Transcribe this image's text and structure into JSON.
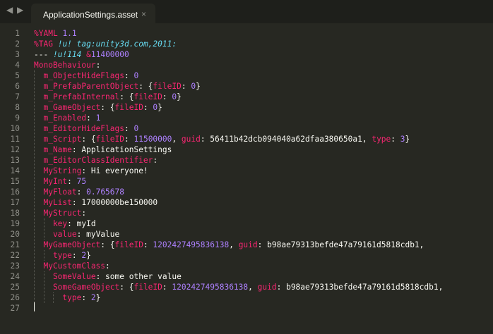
{
  "tab": {
    "title": "ApplicationSettings.asset",
    "close_symbol": "×"
  },
  "nav": {
    "back_symbol": "◀",
    "forward_symbol": "▶"
  },
  "colors": {
    "background": "#272822",
    "key": "#f92672",
    "number": "#ae81ff",
    "string": "#e6db74",
    "tag": "#66d9ef",
    "text": "#f8f8f2"
  },
  "lines": [
    {
      "n": "1",
      "tokens": [
        [
          "%",
          "pink"
        ],
        [
          "YAML",
          "pink"
        ],
        [
          " 1.1",
          "purple"
        ]
      ]
    },
    {
      "n": "2",
      "tokens": [
        [
          "%",
          "pink"
        ],
        [
          "TAG",
          "pink"
        ],
        [
          " !u! tag:unity3d.com,2011:",
          "cyan"
        ]
      ]
    },
    {
      "n": "3",
      "tokens": [
        [
          "--- ",
          "plain"
        ],
        [
          "!u!114",
          "cyan"
        ],
        [
          " &",
          "pink"
        ],
        [
          "11400000",
          "purple"
        ]
      ]
    },
    {
      "n": "4",
      "tokens": [
        [
          "MonoBehaviour",
          "key"
        ],
        [
          ":",
          "punct"
        ]
      ]
    },
    {
      "n": "5",
      "tokens": [
        [
          "  m_ObjectHideFlags",
          "key"
        ],
        [
          ": ",
          "punct"
        ],
        [
          "0",
          "purple"
        ]
      ]
    },
    {
      "n": "6",
      "tokens": [
        [
          "  m_PrefabParentObject",
          "key"
        ],
        [
          ": {",
          "punct"
        ],
        [
          "fileID",
          "key"
        ],
        [
          ": ",
          "punct"
        ],
        [
          "0",
          "purple"
        ],
        [
          "}",
          "punct"
        ]
      ]
    },
    {
      "n": "7",
      "tokens": [
        [
          "  m_PrefabInternal",
          "key"
        ],
        [
          ": {",
          "punct"
        ],
        [
          "fileID",
          "key"
        ],
        [
          ": ",
          "punct"
        ],
        [
          "0",
          "purple"
        ],
        [
          "}",
          "punct"
        ]
      ]
    },
    {
      "n": "8",
      "tokens": [
        [
          "  m_GameObject",
          "key"
        ],
        [
          ": {",
          "punct"
        ],
        [
          "fileID",
          "key"
        ],
        [
          ": ",
          "punct"
        ],
        [
          "0",
          "purple"
        ],
        [
          "}",
          "punct"
        ]
      ]
    },
    {
      "n": "9",
      "tokens": [
        [
          "  m_Enabled",
          "key"
        ],
        [
          ": ",
          "punct"
        ],
        [
          "1",
          "purple"
        ]
      ]
    },
    {
      "n": "10",
      "tokens": [
        [
          "  m_EditorHideFlags",
          "key"
        ],
        [
          ": ",
          "punct"
        ],
        [
          "0",
          "purple"
        ]
      ]
    },
    {
      "n": "11",
      "tokens": [
        [
          "  m_Script",
          "key"
        ],
        [
          ": {",
          "punct"
        ],
        [
          "fileID",
          "key"
        ],
        [
          ": ",
          "punct"
        ],
        [
          "11500000",
          "purple"
        ],
        [
          ", ",
          "punct"
        ],
        [
          "guid",
          "key"
        ],
        [
          ": ",
          "punct"
        ],
        [
          "56411b42dcb094040a62dfaa380650a1",
          "plain"
        ],
        [
          ", ",
          "punct"
        ],
        [
          "type",
          "key"
        ],
        [
          ": ",
          "punct"
        ],
        [
          "3",
          "purple"
        ],
        [
          "}",
          "punct"
        ]
      ]
    },
    {
      "n": "12",
      "tokens": [
        [
          "  m_Name",
          "key"
        ],
        [
          ": ",
          "punct"
        ],
        [
          "ApplicationSettings",
          "plain"
        ]
      ]
    },
    {
      "n": "13",
      "tokens": [
        [
          "  m_EditorClassIdentifier",
          "key"
        ],
        [
          ":",
          "punct"
        ]
      ]
    },
    {
      "n": "14",
      "tokens": [
        [
          "  MyString",
          "key"
        ],
        [
          ": ",
          "punct"
        ],
        [
          "Hi everyone!",
          "plain"
        ]
      ]
    },
    {
      "n": "15",
      "tokens": [
        [
          "  MyInt",
          "key"
        ],
        [
          ": ",
          "punct"
        ],
        [
          "75",
          "purple"
        ]
      ]
    },
    {
      "n": "16",
      "tokens": [
        [
          "  MyFloat",
          "key"
        ],
        [
          ": ",
          "punct"
        ],
        [
          "0.765678",
          "purple"
        ]
      ]
    },
    {
      "n": "17",
      "tokens": [
        [
          "  MyList",
          "key"
        ],
        [
          ": ",
          "punct"
        ],
        [
          "17000000be150000",
          "plain"
        ]
      ]
    },
    {
      "n": "18",
      "tokens": [
        [
          "  MyStruct",
          "key"
        ],
        [
          ":",
          "punct"
        ]
      ]
    },
    {
      "n": "19",
      "tokens": [
        [
          "    key",
          "key"
        ],
        [
          ": ",
          "punct"
        ],
        [
          "myId",
          "plain"
        ]
      ]
    },
    {
      "n": "20",
      "tokens": [
        [
          "    value",
          "key"
        ],
        [
          ": ",
          "punct"
        ],
        [
          "myValue",
          "plain"
        ]
      ]
    },
    {
      "n": "21",
      "tokens": [
        [
          "  MyGameObject",
          "key"
        ],
        [
          ": {",
          "punct"
        ],
        [
          "fileID",
          "key"
        ],
        [
          ": ",
          "punct"
        ],
        [
          "1202427495836138",
          "purple"
        ],
        [
          ", ",
          "punct"
        ],
        [
          "guid",
          "key"
        ],
        [
          ": ",
          "punct"
        ],
        [
          "b98ae79313befde47a79161d5818cdb1",
          "plain"
        ],
        [
          ",",
          "punct"
        ]
      ]
    },
    {
      "n": "22",
      "tokens": [
        [
          "    type",
          "key"
        ],
        [
          ": ",
          "punct"
        ],
        [
          "2",
          "purple"
        ],
        [
          "}",
          "punct"
        ]
      ]
    },
    {
      "n": "23",
      "tokens": [
        [
          "  MyCustomClass",
          "key"
        ],
        [
          ":",
          "punct"
        ]
      ]
    },
    {
      "n": "24",
      "tokens": [
        [
          "    SomeValue",
          "key"
        ],
        [
          ": ",
          "punct"
        ],
        [
          "some other value",
          "plain"
        ]
      ]
    },
    {
      "n": "25",
      "tokens": [
        [
          "    SomeGameObject",
          "key"
        ],
        [
          ": {",
          "punct"
        ],
        [
          "fileID",
          "key"
        ],
        [
          ": ",
          "punct"
        ],
        [
          "1202427495836138",
          "purple"
        ],
        [
          ", ",
          "punct"
        ],
        [
          "guid",
          "key"
        ],
        [
          ": ",
          "punct"
        ],
        [
          "b98ae79313befde47a79161d5818cdb1",
          "plain"
        ],
        [
          ",",
          "punct"
        ]
      ]
    },
    {
      "n": "26",
      "tokens": [
        [
          "      type",
          "key"
        ],
        [
          ": ",
          "punct"
        ],
        [
          "2",
          "purple"
        ],
        [
          "}",
          "punct"
        ]
      ]
    },
    {
      "n": "27",
      "tokens": []
    }
  ]
}
